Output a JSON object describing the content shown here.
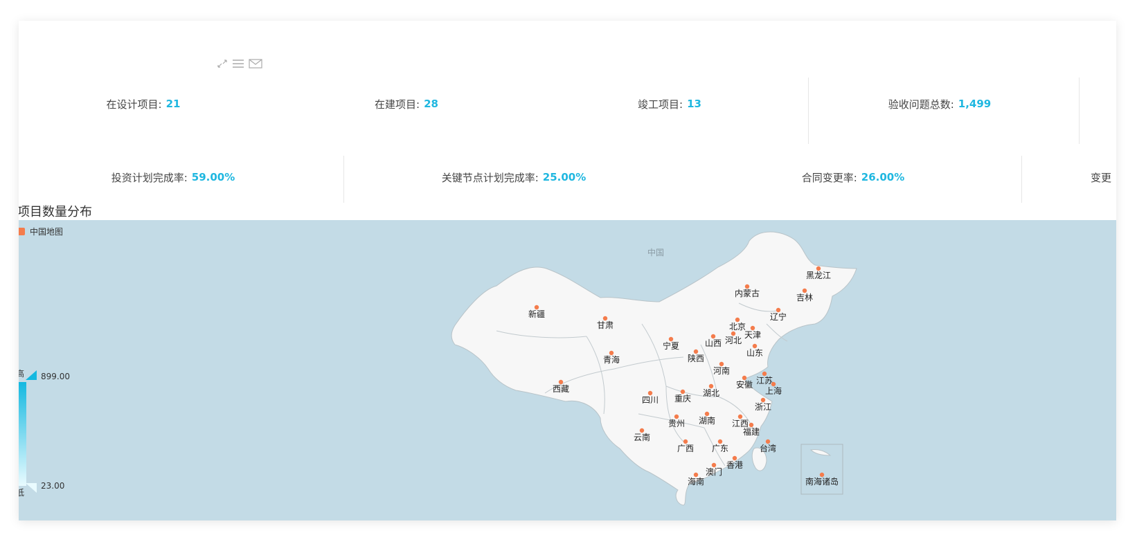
{
  "toolbox": {
    "icons": [
      "fullscreen-icon",
      "menu-icon",
      "mail-icon"
    ]
  },
  "stats_row1": [
    {
      "label": "在设计项目:",
      "value": "21"
    },
    {
      "label": "在建项目:",
      "value": "28"
    },
    {
      "label": "竣工项目:",
      "value": "13"
    },
    {
      "label": "验收问题总数:",
      "value": "1,499"
    }
  ],
  "stats_row2": [
    {
      "label": "投资计划完成率:",
      "value": "59.00%"
    },
    {
      "label": "关键节点计划完成率:",
      "value": "25.00%"
    },
    {
      "label": "合同变更率:",
      "value": "26.00%"
    },
    {
      "label": "变更",
      "value": ""
    }
  ],
  "section_title": "项目数量分布",
  "map": {
    "legend": "中国地图",
    "title": "中国",
    "visual_map": {
      "max": "899.00",
      "min": "23.00",
      "high_text": "高",
      "low_text": "低"
    },
    "colors": {
      "ocean": "#c3dbe6",
      "land": "#f7f7f7",
      "border": "#9aa4a8",
      "dot": "#f47c4c",
      "accent": "#1fb7e0"
    },
    "provinces": [
      "黑龙江",
      "吉林",
      "辽宁",
      "内蒙古",
      "北京",
      "天津",
      "河北",
      "山西",
      "山东",
      "新疆",
      "甘肃",
      "宁夏",
      "陕西",
      "青海",
      "西藏",
      "河南",
      "江苏",
      "安徽",
      "上海",
      "湖北",
      "四川",
      "重庆",
      "浙江",
      "贵州",
      "湖南",
      "江西",
      "福建",
      "云南",
      "广西",
      "广东",
      "台湾",
      "香港",
      "澳门",
      "海南",
      "南海诸岛"
    ]
  }
}
